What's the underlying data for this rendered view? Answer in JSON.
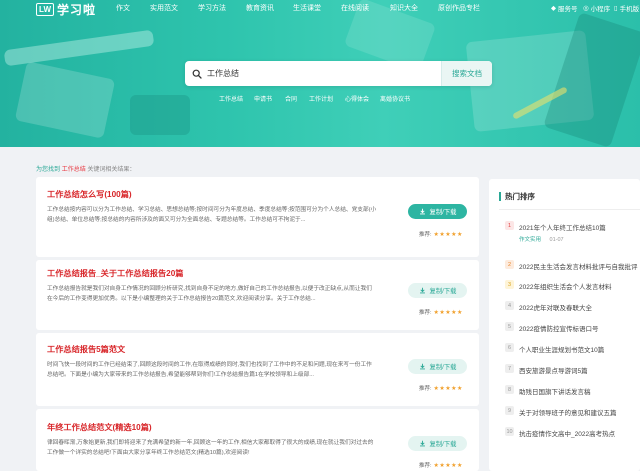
{
  "header": {
    "logo_mark": "LW",
    "logo_text": "学习啦",
    "nav": [
      "作文",
      "实用范文",
      "学习方法",
      "教育资讯",
      "生活课堂",
      "在线阅读",
      "知识大全",
      "原创作品专栏"
    ],
    "right": [
      {
        "icon": "weibo-icon",
        "glyph": "◆",
        "label": "服务号"
      },
      {
        "icon": "mini-program-icon",
        "glyph": "◎",
        "label": "小程序"
      },
      {
        "icon": "phone-icon",
        "glyph": "▯",
        "label": "手机版"
      }
    ]
  },
  "search": {
    "value": "工作总结",
    "button": "搜索文档",
    "tags": [
      "工作总结",
      "申请书",
      "合同",
      "工作计划",
      "心得体会",
      "离婚协议书"
    ]
  },
  "found": {
    "prefix": "为您找到",
    "keyword": "工作总结",
    "suffix": "关键词相关结果："
  },
  "results": [
    {
      "title": "工作总结怎么写(100篇)",
      "desc": "工作总结按内容可以分为工作总结、学习总结、思想总结等;按时间可分为年度总结、季度总结等;按范围可分为个人总结、党支部(小组)总结、单位总结等;按总结的内容所涉及的面又可分为全面总结、专题总结等。工作总结可不拘泥于...",
      "button": "复制/下载",
      "rating_label": "推荐:",
      "stars": "★★★★★"
    },
    {
      "title": "工作总结报告_关于工作总结报告20篇",
      "desc": "工作总结报告就是我们对自身工作情况的回顾分析研究,找到自身不足的地方,做好自己的工作总结报告,以便于改正缺点,从而让我们在今后的工作变得更加优秀。以下是小编整理的关于工作总结报告20篇范文,欢迎阅读分享。关于工作总结...",
      "button": "复制/下载",
      "rating_label": "推荐:",
      "stars": "★★★★★"
    },
    {
      "title": "工作总结报告5篇范文",
      "desc": "时间飞快一段时间的工作已经结束了,回顾这段时间的工作,在取得成绩的同时,我们也找到了工作中的不足和问题,现在来写一份工作总结吧。下面是小编为大家带来的工作总结报告,希望能够帮到你们!工作总结报告篇1在学校领导和上级部...",
      "button": "复制/下载",
      "rating_label": "推荐:",
      "stars": "★★★★★"
    },
    {
      "title": "年终工作总结范文(精选10篇)",
      "desc": "律回春晖渐,万象始更新,我们即将迎来了充满希望的新一年,回顾这一年的工作,相信大家都取得了很大的成绩,现在就让我们对过去的工作做一个详实的总结吧!下面由大家分享年终工作总结范文(精选10篇),欢迎阅读!",
      "button": "复制/下载",
      "rating_label": "推荐:",
      "stars": "★★★★★"
    }
  ],
  "sidebar": {
    "title": "热门排序",
    "items": [
      "2021年个人年终工作总结10篇",
      "2022民主生活会发言材料批评与自我批评",
      "2022年组织生活会个人发言材料",
      "2022虎年对联及春联大全",
      "2022疫情防控宣传标语口号",
      "个人职业生涯规划书范文10篇",
      "西安旅游景点导游词5篇",
      "助残日国旗下讲话发言稿",
      "关于对领导班子的意见和建议五篇",
      "抗击疫情作文高中_2022高考热点"
    ],
    "meta_category": "作文实用",
    "meta_date": "01-07"
  },
  "colors": {
    "accent": "#2db5a2",
    "title_red": "#d8262a",
    "star": "#f1a02c"
  }
}
